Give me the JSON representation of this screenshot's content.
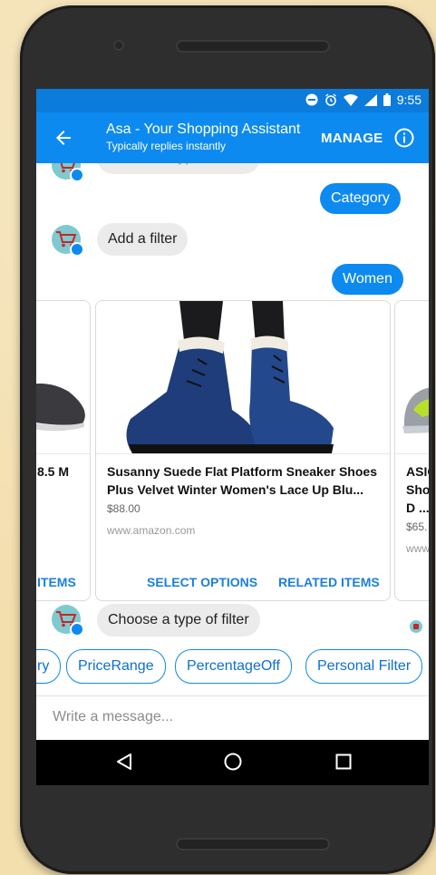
{
  "status": {
    "time": "9:55"
  },
  "header": {
    "title": "Asa - Your Shopping Assistant",
    "subtitle": "Typically replies instantly",
    "manage_label": "MANAGE"
  },
  "messages": [
    {
      "from": "bot",
      "text": "Choose a type of filter"
    },
    {
      "from": "user",
      "text": "Category"
    },
    {
      "from": "bot",
      "text": "Add a filter"
    },
    {
      "from": "user",
      "text": "Women"
    },
    {
      "from": "bot",
      "text": "Choose a type of filter"
    }
  ],
  "cards": [
    {
      "title_fragment": "8.5 M",
      "action": "ITEMS"
    },
    {
      "title": "Susanny Suede Flat Platform Sneaker Shoes Plus Velvet Winter Women's Lace Up Blu...",
      "price": "$88.00",
      "source": "www.amazon.com",
      "action_select": "SELECT OPTIONS",
      "action_related": "RELATED ITEMS"
    },
    {
      "title_line1": "ASIC",
      "title_line2": "Sho",
      "title_line3": "D ...",
      "price": "$65.",
      "source": "www"
    }
  ],
  "quick_replies": [
    "ry",
    "PriceRange",
    "PercentageOff",
    "Personal Filter"
  ],
  "composer": {
    "placeholder": "Write a message..."
  },
  "colors": {
    "brand_blue": "#0d8af0",
    "status_blue": "#0b7bdc",
    "bubble_gray": "#ebebeb"
  },
  "icons": [
    "back-arrow-icon",
    "info-icon",
    "cart-icon",
    "messenger-badge-icon",
    "back-triangle-icon",
    "home-circle-icon",
    "recents-square-icon"
  ]
}
